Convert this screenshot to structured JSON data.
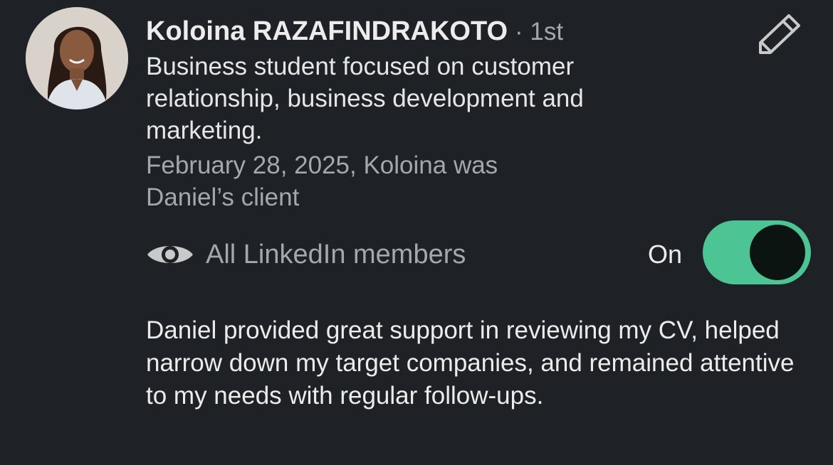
{
  "author": {
    "name": "Koloina RAZAFINDRAKOTO",
    "degree": "· 1st",
    "headline": "Business student focused on customer relationship, business development and marketing.",
    "relation": "February 28, 2025, Koloina was Daniel’s client"
  },
  "icons": {
    "edit": "pencil-icon",
    "visibility": "eye-icon"
  },
  "visibility": {
    "label": "All LinkedIn members",
    "toggle_state_label": "On",
    "enabled": true
  },
  "recommendation": {
    "text": "Daniel provided great support in reviewing my CV, helped narrow down my target companies, and remained attentive to my needs with regular follow-ups."
  },
  "colors": {
    "background": "#1e2226",
    "toggle_on": "#4cc494",
    "secondary_text": "#a4a8ac"
  }
}
